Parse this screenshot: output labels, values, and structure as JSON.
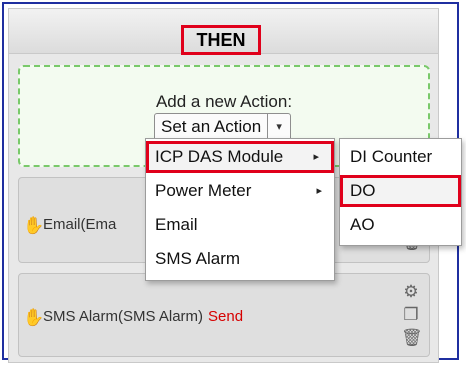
{
  "header": {
    "title": "THEN"
  },
  "drop_zone": {
    "label": "Add a new Action:",
    "select_label": "Set an Action",
    "select_caret": "▾"
  },
  "cards": [
    {
      "text": "Email(Ema",
      "action": ""
    },
    {
      "text": "SMS Alarm(SMS Alarm)",
      "action": "Send"
    }
  ],
  "menu": {
    "items": [
      {
        "label": "ICP DAS Module",
        "has_submenu": true,
        "highlighted": true
      },
      {
        "label": "Power Meter",
        "has_submenu": true,
        "highlighted": false
      },
      {
        "label": "Email",
        "has_submenu": false,
        "highlighted": false
      },
      {
        "label": "SMS Alarm",
        "has_submenu": false,
        "highlighted": false
      }
    ],
    "submenu_arrow": "▸"
  },
  "submenu": {
    "items": [
      {
        "label": "DI Counter",
        "highlighted": false
      },
      {
        "label": "DO",
        "highlighted": true
      },
      {
        "label": "AO",
        "highlighted": false
      }
    ]
  },
  "icons": {
    "hand": "hand-drag-icon",
    "settings": "gear-icon",
    "copy": "copy-icon",
    "delete": "trash-icon"
  },
  "colors": {
    "highlight_border": "#e0001b",
    "frame_border": "#1f2fa0",
    "drop_zone_border": "#79c96a",
    "send_text": "#d60000"
  }
}
